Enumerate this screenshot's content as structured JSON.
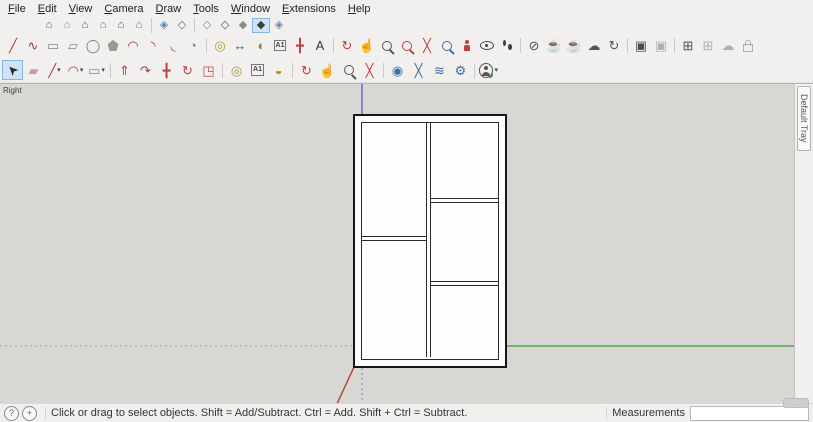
{
  "menu": [
    "File",
    "Edit",
    "View",
    "Camera",
    "Draw",
    "Tools",
    "Window",
    "Extensions",
    "Help"
  ],
  "colors": {
    "selection_highlight": "#cfe3f6",
    "axis_red": "#b0493f",
    "axis_green": "#55a855",
    "axis_blue": "#6b6bc8",
    "canvas_background": "#d8d7d3"
  },
  "toolbars": {
    "row1": [
      [
        {
          "id": "iso-view",
          "glyph": "⌂",
          "color": "#7a5a3c"
        },
        {
          "id": "top-view",
          "glyph": "⌂",
          "color": "#8a8a84"
        },
        {
          "id": "front-view",
          "glyph": "⌂",
          "color": "#50504a"
        },
        {
          "id": "right-view",
          "glyph": "⌂",
          "color": "#6b6b65"
        },
        {
          "id": "back-view",
          "glyph": "⌂",
          "color": "#50504a"
        },
        {
          "id": "left-view",
          "glyph": "⌂",
          "color": "#6b6b65"
        }
      ],
      [
        {
          "id": "x-ray-style",
          "glyph": "◈",
          "color": "#5b87b5"
        },
        {
          "id": "back-edges-style",
          "glyph": "◇",
          "color": "#6b6b65"
        }
      ],
      [
        {
          "id": "wireframe-style",
          "glyph": "◇",
          "color": "#8a8a84"
        },
        {
          "id": "hidden-line-style",
          "glyph": "◇",
          "color": "#50504a"
        },
        {
          "id": "shaded-style",
          "glyph": "◆",
          "color": "#8a8a84"
        },
        {
          "id": "shaded-with-textures-style",
          "glyph": "◆",
          "color": "#3c3c38",
          "pressed": true
        },
        {
          "id": "monochrome-style",
          "glyph": "◈",
          "color": "#6d89a8"
        }
      ]
    ],
    "row2": [
      [
        {
          "id": "line-tool",
          "glyph": "╱",
          "color": "#a23b3b"
        },
        {
          "id": "freehand-tool",
          "glyph": "∿",
          "color": "#a23b3b"
        },
        {
          "id": "rectangle-tool",
          "glyph": "▭",
          "color": "#8a8a84"
        },
        {
          "id": "rotated-rectangle-tool",
          "glyph": "▱",
          "color": "#8a8a84"
        },
        {
          "id": "circle-tool",
          "glyph": "◯",
          "color": "#77776f"
        },
        {
          "id": "polygon-tool",
          "css": "pent",
          "color": "#9a9a92"
        },
        {
          "id": "arc-tool",
          "glyph": "◠",
          "color": "#a23b3b"
        },
        {
          "id": "two-point-arc-tool",
          "glyph": "◝",
          "color": "#a23b3b"
        },
        {
          "id": "three-point-arc-tool",
          "glyph": "◟",
          "color": "#a23b3b"
        },
        {
          "id": "pie-tool",
          "glyph": "◔",
          "color": "#85857d"
        }
      ],
      [
        {
          "id": "tape-measure-tool",
          "glyph": "◎",
          "color": "#b09a2f"
        },
        {
          "id": "dimension-tool",
          "glyph": "↔",
          "color": "#55554f"
        },
        {
          "id": "protractor-tool",
          "glyph": "◖",
          "color": "#7c8a3c"
        },
        {
          "id": "text-tool",
          "glyph": "A1",
          "box": true,
          "color": "#44443f"
        },
        {
          "id": "axes-tool",
          "glyph": "╋",
          "color": "#bf4040"
        },
        {
          "id": "3d-text-tool",
          "glyph": "A",
          "color": "#3a3a35"
        }
      ],
      [
        {
          "id": "orbit-tool",
          "glyph": "↻",
          "color": "#bf4040"
        },
        {
          "id": "pan-tool",
          "glyph": "☝",
          "color": "#c49a58"
        },
        {
          "id": "zoom-tool",
          "css": "mag",
          "color": "#55554f"
        },
        {
          "id": "zoom-window-tool",
          "css": "mag",
          "color": "#bf4040"
        },
        {
          "id": "zoom-extents-tool",
          "glyph": "╳",
          "color": "#bf4040"
        },
        {
          "id": "zoom-previous-tool",
          "css": "mag",
          "color": "#3f6fa8"
        },
        {
          "id": "position-camera-tool",
          "css": "person",
          "color": "#bf4040"
        },
        {
          "id": "look-around-tool",
          "css": "eye",
          "color": "#44443f"
        },
        {
          "id": "walk-tool",
          "css": "feet",
          "color": "#44443f"
        }
      ],
      [
        {
          "id": "no-entry",
          "glyph": "⊘",
          "color": "#55554f"
        },
        {
          "id": "get-models",
          "glyph": "☕",
          "color": "#55554f"
        },
        {
          "id": "share-model",
          "glyph": "☕",
          "color": "#6a6a64"
        },
        {
          "id": "cloud",
          "glyph": "☁",
          "color": "#55554f"
        },
        {
          "id": "sync",
          "glyph": "↻",
          "color": "#55554f"
        }
      ],
      [
        {
          "id": "terrain-image",
          "glyph": "▣",
          "color": "#50504a"
        },
        {
          "id": "image",
          "glyph": "▣",
          "color": "#50504a",
          "disabled": true
        }
      ],
      [
        {
          "id": "window",
          "glyph": "⊞",
          "color": "#50504a"
        },
        {
          "id": "window-settings",
          "glyph": "⊞",
          "color": "#50504a",
          "disabled": true
        },
        {
          "id": "cloud-image",
          "glyph": "☁",
          "color": "#50504a",
          "disabled": true
        },
        {
          "id": "lock",
          "css": "lock",
          "color": "#50504a",
          "disabled": true
        }
      ]
    ],
    "row3": [
      [
        {
          "id": "select-tool",
          "glyph": "➤",
          "rot": -135,
          "color": "#2a2a2a",
          "pressed": true
        },
        {
          "id": "eraser-tool",
          "glyph": "▰",
          "color": "#d394a6"
        },
        {
          "id": "line-tool",
          "glyph": "╱",
          "color": "#a23b3b",
          "dd": true
        },
        {
          "id": "arc-tool",
          "glyph": "◠",
          "color": "#a23b3b",
          "dd": true
        },
        {
          "id": "rectangle-tool",
          "glyph": "▭",
          "color": "#8a8a84",
          "dd": true
        }
      ],
      [
        {
          "id": "push-pull-tool",
          "glyph": "⇑",
          "color": "#a8403a"
        },
        {
          "id": "follow-me-tool",
          "glyph": "↷",
          "color": "#a8403a"
        },
        {
          "id": "move-tool",
          "glyph": "╋",
          "color": "#bf4040"
        },
        {
          "id": "rotate-tool",
          "glyph": "↻",
          "color": "#bf4040"
        },
        {
          "id": "scale-tool",
          "glyph": "◳",
          "color": "#bf4040"
        }
      ],
      [
        {
          "id": "tape-measure-tool",
          "glyph": "◎",
          "color": "#b09a2f"
        },
        {
          "id": "text-tool",
          "glyph": "A1",
          "box": true,
          "color": "#44443f"
        },
        {
          "id": "paint-bucket-tool",
          "glyph": "◒",
          "color": "#b8860b"
        }
      ],
      [
        {
          "id": "orbit-tool",
          "glyph": "↻",
          "color": "#bf4040"
        },
        {
          "id": "pan-tool",
          "glyph": "☝",
          "color": "#c49a58"
        },
        {
          "id": "zoom-tool",
          "css": "mag",
          "color": "#55554f"
        },
        {
          "id": "zoom-extents-tool",
          "glyph": "╳",
          "color": "#bf4040"
        }
      ],
      [
        {
          "id": "extension-spiral",
          "glyph": "◉",
          "color": "#3f6fa8"
        },
        {
          "id": "extension-cross",
          "glyph": "╳",
          "color": "#3f6fa8"
        },
        {
          "id": "extension-layers",
          "glyph": "≋",
          "color": "#3f6fa8"
        },
        {
          "id": "extension-gear",
          "glyph": "⚙",
          "color": "#3f6fa8"
        }
      ],
      [
        {
          "id": "account",
          "css": "acct",
          "color": "#555",
          "dd": true
        }
      ]
    ]
  },
  "viewport": {
    "view_label": "Right",
    "tray_tab": "Default Tray"
  },
  "statusbar": {
    "icons": [
      {
        "id": "status-help",
        "glyph": "?"
      },
      {
        "id": "status-add",
        "glyph": "+"
      }
    ],
    "hint": "Click or drag to select objects. Shift = Add/Subtract. Ctrl = Add. Shift + Ctrl = Subtract.",
    "measurements_label": "Measurements",
    "measurements_value": ""
  }
}
